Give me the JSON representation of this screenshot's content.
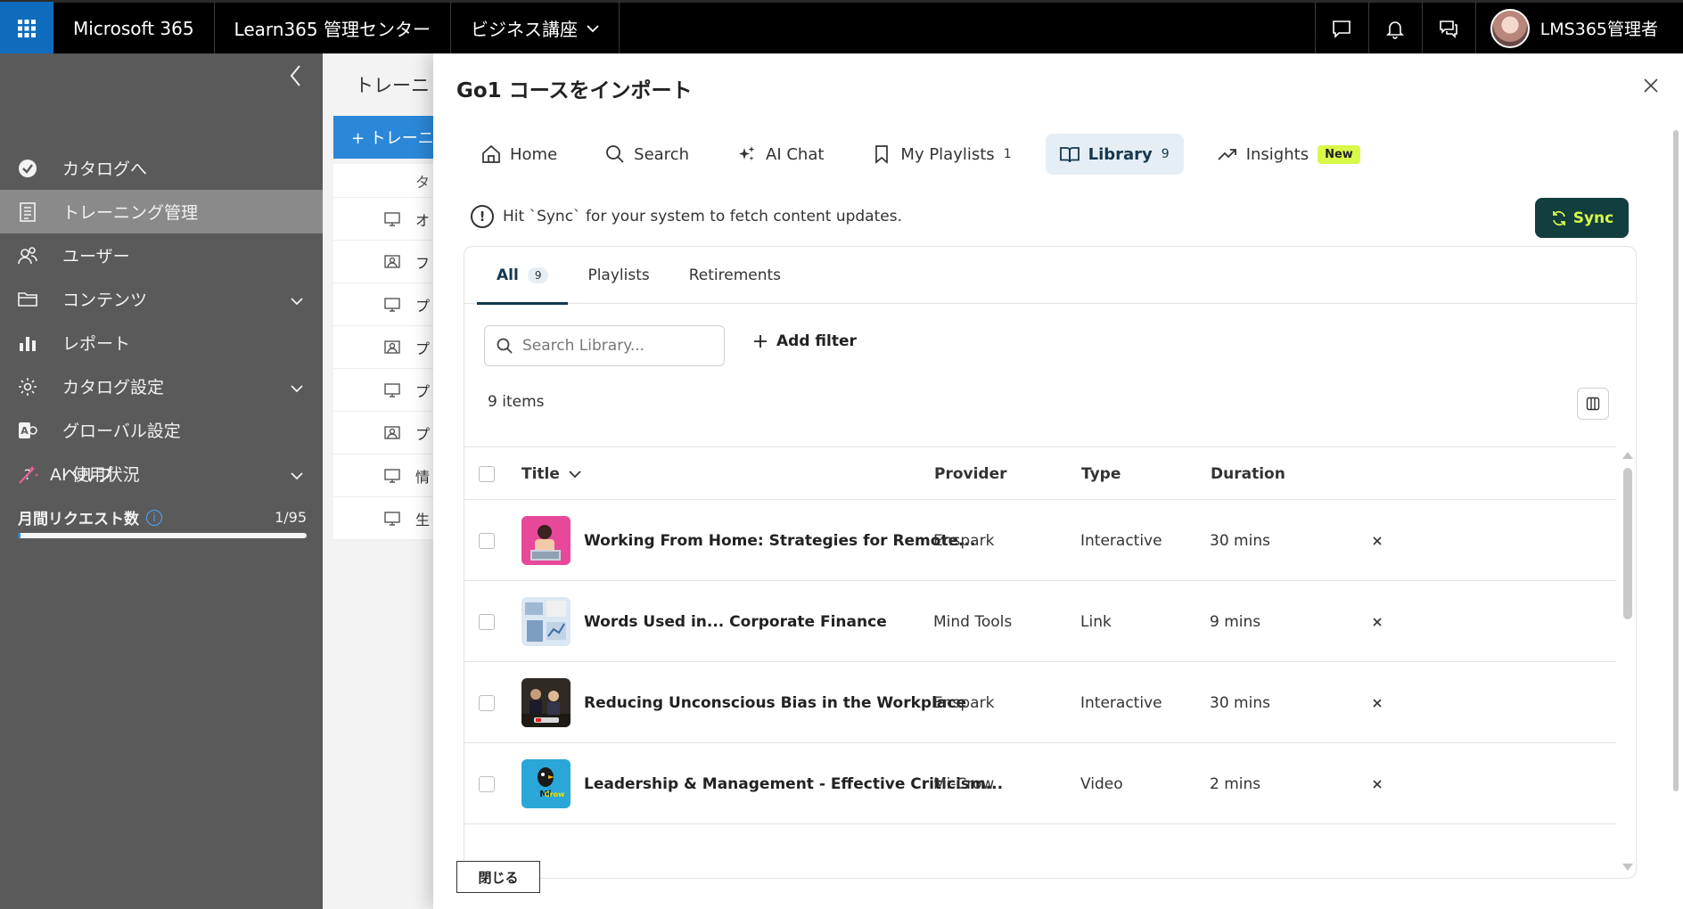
{
  "topbar": {
    "app_name": "Microsoft 365",
    "center_name": "Learn365 管理センター",
    "course_label": "ビジネス講座",
    "user_name": "LMS365管理者",
    "icons": [
      "app-launcher-icon",
      "chat-icon",
      "bell-icon",
      "feedback-icon"
    ]
  },
  "sidebar": {
    "items": [
      {
        "label": "カタログへ",
        "icon": "check-circle-icon",
        "expandable": false,
        "active": false
      },
      {
        "label": "トレーニング管理",
        "icon": "document-icon",
        "expandable": false,
        "active": true
      },
      {
        "label": "ユーザー",
        "icon": "users-icon",
        "expandable": false,
        "active": false
      },
      {
        "label": "コンテンツ",
        "icon": "folder-icon",
        "expandable": true,
        "active": false
      },
      {
        "label": "レポート",
        "icon": "bar-chart-icon",
        "expandable": false,
        "active": false
      },
      {
        "label": "カタログ設定",
        "icon": "gear-icon",
        "expandable": true,
        "active": false
      },
      {
        "label": "グローバル設定",
        "icon": "global-settings-icon",
        "expandable": false,
        "active": false
      },
      {
        "label": "ヘルプ",
        "icon": "help-icon",
        "expandable": true,
        "active": false
      }
    ],
    "ai_usage_label": "AI 使用状況",
    "monthly_requests_label": "月間リクエスト数",
    "monthly_requests_count": "1/95",
    "monthly_requests_fraction": 0.0105
  },
  "background_page": {
    "title": "トレーニ",
    "new_button": "+ トレーニ",
    "column_header": "タ",
    "rows": [
      "オ",
      "フ",
      "プ",
      "プ",
      "プ",
      "プ",
      "情",
      "生"
    ]
  },
  "modal": {
    "title": "Go1 コースをインポート",
    "nav": [
      {
        "label": "Home",
        "icon": "home-icon",
        "count": "",
        "badge": "",
        "active": false
      },
      {
        "label": "Search",
        "icon": "search-icon",
        "count": "",
        "badge": "",
        "active": false
      },
      {
        "label": "AI Chat",
        "icon": "sparkle-icon",
        "count": "",
        "badge": "",
        "active": false
      },
      {
        "label": "My Playlists",
        "icon": "bookmark-icon",
        "count": "1",
        "badge": "",
        "active": false
      },
      {
        "label": "Library",
        "icon": "book-icon",
        "count": "9",
        "badge": "",
        "active": true
      },
      {
        "label": "Insights",
        "icon": "trend-icon",
        "count": "",
        "badge": "New",
        "active": false
      }
    ],
    "hint_text": "Hit `Sync` for your system to fetch content updates.",
    "sync_label": "Sync",
    "tabs": [
      {
        "label": "All",
        "count": "9",
        "active": true
      },
      {
        "label": "Playlists",
        "count": "",
        "active": false
      },
      {
        "label": "Retirements",
        "count": "",
        "active": false
      }
    ],
    "search_placeholder": "Search Library...",
    "add_filter_label": "Add filter",
    "items_count": "9 items",
    "columns": {
      "title": "Title",
      "provider": "Provider",
      "type": "Type",
      "duration": "Duration"
    },
    "rows": [
      {
        "title": "Working From Home: Strategies for Remote...",
        "provider": "Enspark",
        "type": "Interactive",
        "duration": "30 mins",
        "thumb": "remote-work-thumbnail"
      },
      {
        "title": "Words Used in... Corporate Finance",
        "provider": "Mind Tools",
        "type": "Link",
        "duration": "9 mins",
        "thumb": "finance-thumbnail"
      },
      {
        "title": "Reducing Unconscious Bias in the Workplace",
        "provider": "Enspark",
        "type": "Interactive",
        "duration": "30 mins",
        "thumb": "bias-thumbnail"
      },
      {
        "title": "Leadership & Management - Effective Criticism...",
        "provider": "Mi-Crow",
        "type": "Video",
        "duration": "2 mins",
        "thumb": "mi-crow-thumbnail"
      }
    ],
    "close_label": "閉じる"
  },
  "colors": {
    "topbar_bg": "#000000",
    "waffle_bg": "#0f6cbd",
    "sidebar_bg": "#5a5a5a",
    "sidebar_active": "#8a8a8a",
    "sync_bg": "#133e3e",
    "sync_text": "#d9f94a",
    "new_badge": "#d9f94a",
    "active_tab": "#14384f"
  }
}
